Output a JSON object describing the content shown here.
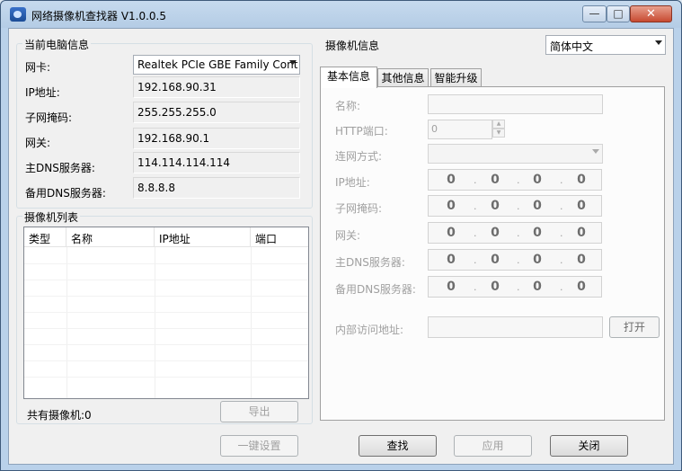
{
  "window": {
    "title": "网络摄像机查找器 V1.0.0.5",
    "min_glyph": "—",
    "max_glyph": "□",
    "close_glyph": "✕"
  },
  "pc_info": {
    "group_title": "当前电脑信息",
    "nic_label": "网卡:",
    "nic_value": "Realtek PCIe GBE Family Cont",
    "ip_label": "IP地址:",
    "ip_value": "192.168.90.31",
    "mask_label": "子网掩码:",
    "mask_value": "255.255.255.0",
    "gateway_label": "网关:",
    "gateway_value": "192.168.90.1",
    "dns1_label": "主DNS服务器:",
    "dns1_value": "114.114.114.114",
    "dns2_label": "备用DNS服务器:",
    "dns2_value": "8.8.8.8"
  },
  "camera_list": {
    "group_title": "摄像机列表",
    "columns": [
      "类型",
      "名称",
      "IP地址",
      "端口"
    ],
    "total_text": "共有摄像机:0",
    "export_label": "导出"
  },
  "camera_info": {
    "title": "摄像机信息",
    "language": "简体中文",
    "tabs": [
      "基本信息",
      "其他信息",
      "智能升级"
    ],
    "name_label": "名称:",
    "http_port_label": "HTTP端口:",
    "http_port_value": "0",
    "connect_mode_label": "连网方式:",
    "ip_label": "IP地址:",
    "mask_label": "子网掩码:",
    "gateway_label": "网关:",
    "dns1_label": "主DNS服务器:",
    "dns2_label": "备用DNS服务器:",
    "ip_octet": "0",
    "ip_dot": ".",
    "internal_addr_label": "内部访问地址:",
    "open_label": "打开"
  },
  "bottom_buttons": {
    "one_key": "一键设置",
    "search": "查找",
    "apply": "应用",
    "close": "关闭"
  }
}
